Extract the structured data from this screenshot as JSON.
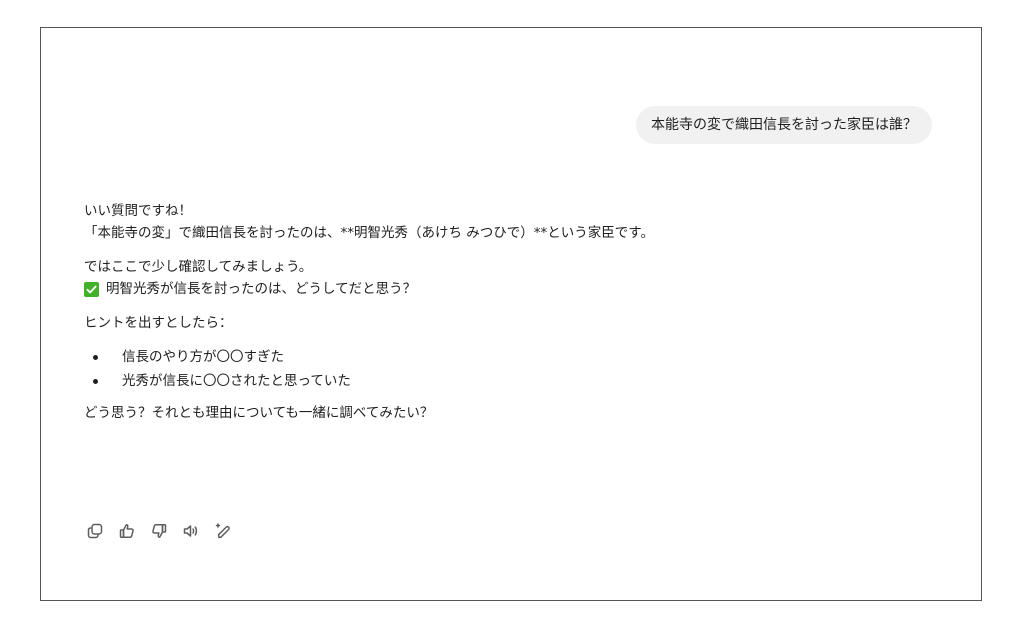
{
  "user_message": "本能寺の変で織田信長を討った家臣は誰？",
  "assistant": {
    "paragraph1": [
      "いい質問ですね！",
      "「本能寺の変」で織田信長を討ったのは、**明智光秀（あけち みつひで）**という家臣です。"
    ],
    "paragraph2_line1": "ではここで少し確認してみましょう。",
    "check_question": "明智光秀が信長を討ったのは、どうしてだと思う？",
    "hint_intro": "ヒントを出すとしたら：",
    "hints": [
      "信長のやり方が〇〇すぎた",
      "光秀が信長に〇〇されたと思っていた"
    ],
    "closing": "どう思う？それとも理由についても一緒に調べてみたい？"
  },
  "actions": [
    {
      "icon": "copy-icon"
    },
    {
      "icon": "thumbs-up-icon"
    },
    {
      "icon": "thumbs-down-icon"
    },
    {
      "icon": "read-aloud-icon"
    },
    {
      "icon": "edit-sparkle-icon"
    }
  ],
  "colors": {
    "bubble_bg": "#f1f1f1",
    "check_green": "#43b02a",
    "icon_gray": "#5d5d5d"
  }
}
